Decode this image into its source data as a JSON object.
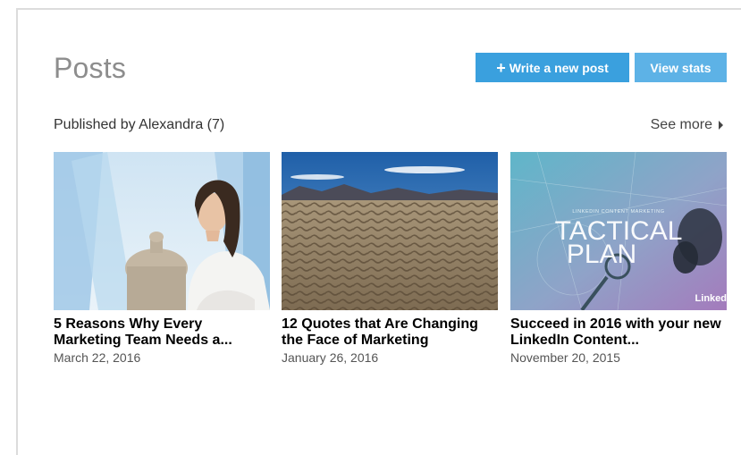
{
  "header": {
    "title": "Posts",
    "write_button": "Write a new post",
    "write_button_icon": "plus-icon",
    "stats_button": "View stats"
  },
  "section": {
    "published_label": "Published by Alexandra (7)",
    "see_more": "See more",
    "see_more_icon": "caret-right-icon"
  },
  "posts": [
    {
      "title": "5 Reasons Why Every Marketing Team Needs a...",
      "date": "March 22, 2016",
      "image": "woman-city-photo"
    },
    {
      "title": "12 Quotes that Are Changing the Face of Marketing",
      "date": "January 26, 2016",
      "image": "desert-dunes-photo"
    },
    {
      "title": "Succeed in 2016 with your new LinkedIn Content...",
      "date": "November 20, 2015",
      "image": "tactical-plan-graphic",
      "image_text": {
        "small_caption": "LINKEDIN CONTENT MARKETING",
        "line1": "TACTICAL",
        "line2": "PLAN",
        "corner": "Linked"
      }
    }
  ],
  "colors": {
    "primary_button": "#3aa0de",
    "secondary_button": "#5db2e6",
    "title_gray": "#8d8d8d"
  }
}
